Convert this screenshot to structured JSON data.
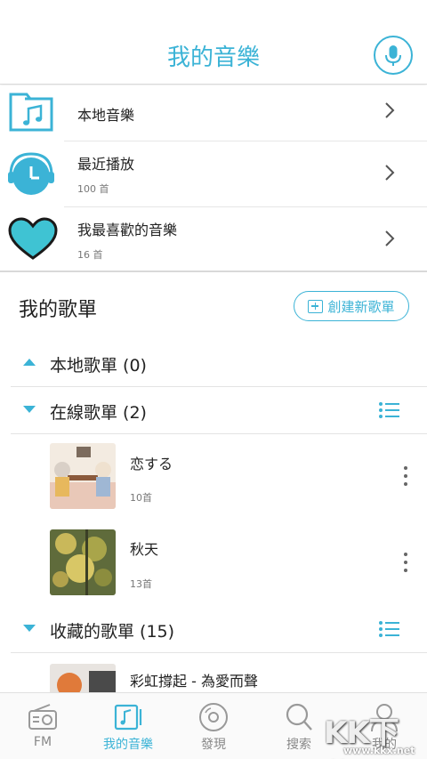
{
  "header": {
    "title": "我的音樂",
    "mic_icon": "microphone-icon",
    "accent": "#3bb3d6"
  },
  "quick_items": [
    {
      "title": "本地音樂",
      "sub": "",
      "icon": "folder-music-icon"
    },
    {
      "title": "最近播放",
      "sub": "100 首",
      "icon": "clock-headphone-icon"
    },
    {
      "title": "我最喜歡的音樂",
      "sub": "16 首",
      "icon": "heart-icon"
    }
  ],
  "section": {
    "title": "我的歌單",
    "create_label": "創建新歌單"
  },
  "groups": [
    {
      "label": "本地歌單 (0)",
      "expanded": false
    },
    {
      "label": "在線歌單 (2)",
      "expanded": true
    },
    {
      "label": "收藏的歌單 (15)",
      "expanded": true
    }
  ],
  "playlists": [
    {
      "name": "恋する",
      "count": "10首"
    },
    {
      "name": "秋天",
      "count": "13首"
    },
    {
      "name": "彩虹撐起 - 為愛而聲",
      "count": ""
    }
  ],
  "tabs": [
    {
      "label": "FM",
      "icon": "radio-icon",
      "active": false
    },
    {
      "label": "我的音樂",
      "icon": "music-library-icon",
      "active": true
    },
    {
      "label": "發現",
      "icon": "disc-icon",
      "active": false
    },
    {
      "label": "搜索",
      "icon": "search-icon",
      "active": false
    },
    {
      "label": "我的",
      "icon": "person-icon",
      "active": false
    }
  ],
  "watermark": {
    "big": "KK下載",
    "small": "www.kkx.net"
  }
}
